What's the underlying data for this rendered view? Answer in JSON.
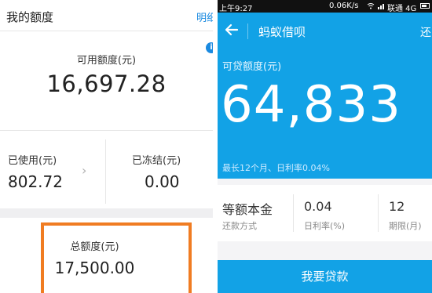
{
  "left": {
    "header": {
      "title": "我的额度",
      "detail_link": "明细"
    },
    "available": {
      "label": "可用额度(元)",
      "value": "16,697.28"
    },
    "used": {
      "label": "已使用(元)",
      "value": "802.72"
    },
    "frozen": {
      "label": "已冻结(元)",
      "value": "0.00"
    },
    "total": {
      "label": "总额度(元)",
      "value": "17,500.00"
    },
    "info_icon_glyph": "i",
    "highlight_color": "#f07c22"
  },
  "right": {
    "status_bar": {
      "time": "上午9:27",
      "speed": "0.06K/s",
      "carrier": "联通 4G"
    },
    "nav": {
      "title": "蚂蚁借呗",
      "right_text": "还"
    },
    "hero": {
      "label": "可贷额度(元)",
      "value": "64,833",
      "subtitle": "最长12个月、日利率0.04%"
    },
    "terms": [
      {
        "value": "等额本金",
        "label": "还款方式"
      },
      {
        "value": "0.04",
        "label": "日利率(%)"
      },
      {
        "value": "12",
        "label": "期限(月)"
      }
    ],
    "apply_button": "我要贷款",
    "accent_color": "#12a2e6"
  }
}
